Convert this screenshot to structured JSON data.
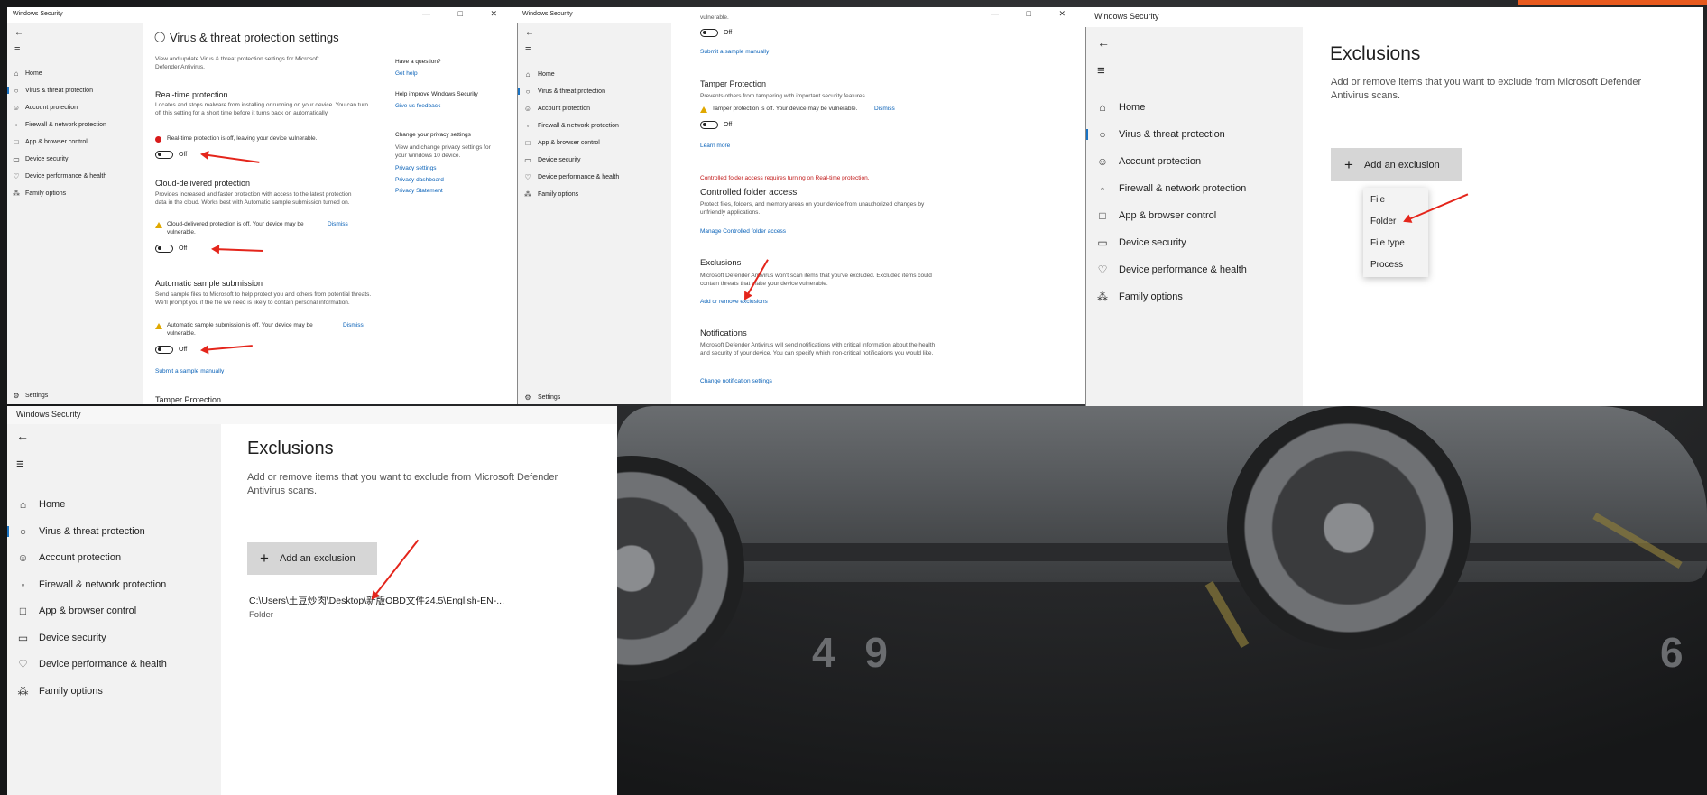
{
  "app_title": "Windows Security",
  "window_controls": "— □ ✕",
  "nav": {
    "back_glyph": "←",
    "menu_glyph": "≡",
    "items": [
      {
        "label": "Home",
        "icon": "home-icon",
        "glyph": "⌂"
      },
      {
        "label": "Virus & threat protection",
        "icon": "shield-icon",
        "glyph": "○"
      },
      {
        "label": "Account protection",
        "icon": "person-icon",
        "glyph": "&#9786;"
      },
      {
        "label": "Firewall & network protection",
        "icon": "wifi-icon",
        "glyph": "◦"
      },
      {
        "label": "App & browser control",
        "icon": "window-icon",
        "glyph": "□"
      },
      {
        "label": "Device security",
        "icon": "laptop-icon",
        "glyph": "▭"
      },
      {
        "label": "Device performance & health",
        "icon": "heart-icon",
        "glyph": "♡"
      },
      {
        "label": "Family options",
        "icon": "family-icon",
        "glyph": "⁂"
      }
    ],
    "settings_label": "Settings"
  },
  "panel1": {
    "title": "Virus & threat protection settings",
    "description": "View and update Virus & threat protection settings for Microsoft Defender Antivirus.",
    "realtime": {
      "heading": "Real-time protection",
      "description": "Locates and stops malware from installing or running on your device. You can turn off this setting for a short time before it turns back on automatically.",
      "error": "Real-time protection is off, leaving your device vulnerable.",
      "toggle": "Off"
    },
    "cloud": {
      "heading": "Cloud-delivered protection",
      "description": "Provides increased and faster protection with access to the latest protection data in the cloud. Works best with Automatic sample submission turned on.",
      "warning": "Cloud-delivered protection is off. Your device may be vulnerable.",
      "dismiss": "Dismiss",
      "toggle": "Off"
    },
    "sample": {
      "heading": "Automatic sample submission",
      "description": "Send sample files to Microsoft to help protect you and others from potential threats. We'll prompt you if the file we need is likely to contain personal information.",
      "warning": "Automatic sample submission is off. Your device may be vulnerable.",
      "dismiss": "Dismiss",
      "toggle": "Off",
      "link": "Submit a sample manually"
    },
    "tamper_heading": "Tamper Protection",
    "right": {
      "question": "Have a question?",
      "get_help": "Get help",
      "improve": "Help improve Windows Security",
      "feedback": "Give us feedback",
      "privacy_heading": "Change your privacy settings",
      "privacy_desc": "View and change privacy settings for your Windows 10 device.",
      "privacy_settings": "Privacy settings",
      "privacy_dashboard": "Privacy dashboard",
      "privacy_statement": "Privacy Statement"
    }
  },
  "panel2": {
    "top_partial": "vulnerable.",
    "top_toggle": "Off",
    "submit_link": "Submit a sample manually",
    "tamper": {
      "heading": "Tamper Protection",
      "description": "Prevents others from tampering with important security features.",
      "warning": "Tamper protection is off. Your device may be vulnerable.",
      "dismiss": "Dismiss",
      "toggle": "Off",
      "learn_more": "Learn more"
    },
    "cfa_error": "Controlled folder access requires turning on Real-time protection.",
    "cfa": {
      "heading": "Controlled folder access",
      "description": "Protect files, folders, and memory areas on your device from unauthorized changes by unfriendly applications.",
      "link": "Manage Controlled folder access"
    },
    "exclusions": {
      "heading": "Exclusions",
      "description": "Microsoft Defender Antivirus won't scan items that you've excluded. Excluded items could contain threats that make your device vulnerable.",
      "link": "Add or remove exclusions"
    },
    "notifications": {
      "heading": "Notifications",
      "description": "Microsoft Defender Antivirus will send notifications with critical information about the health and security of your device. You can specify which non-critical notifications you would like.",
      "link": "Change notification settings"
    }
  },
  "panel3": {
    "title": "Exclusions",
    "description": "Add or remove items that you want to exclude from Microsoft Defender Antivirus scans.",
    "add_button": "Add an exclusion",
    "plus": "+",
    "menu": [
      "File",
      "Folder",
      "File type",
      "Process"
    ]
  },
  "panel4": {
    "title": "Exclusions",
    "description": "Add or remove items that you want to exclude from Microsoft Defender Antivirus scans.",
    "add_button": "Add an exclusion",
    "plus": "+",
    "entry_path": "C:\\Users\\土豆炒肉\\Desktop\\新版OBD文件24.5\\English-EN-...",
    "entry_type": "Folder"
  },
  "background": {
    "floor_number": "4 9",
    "floor_number2": "6",
    "accent": "#e85a1e"
  }
}
